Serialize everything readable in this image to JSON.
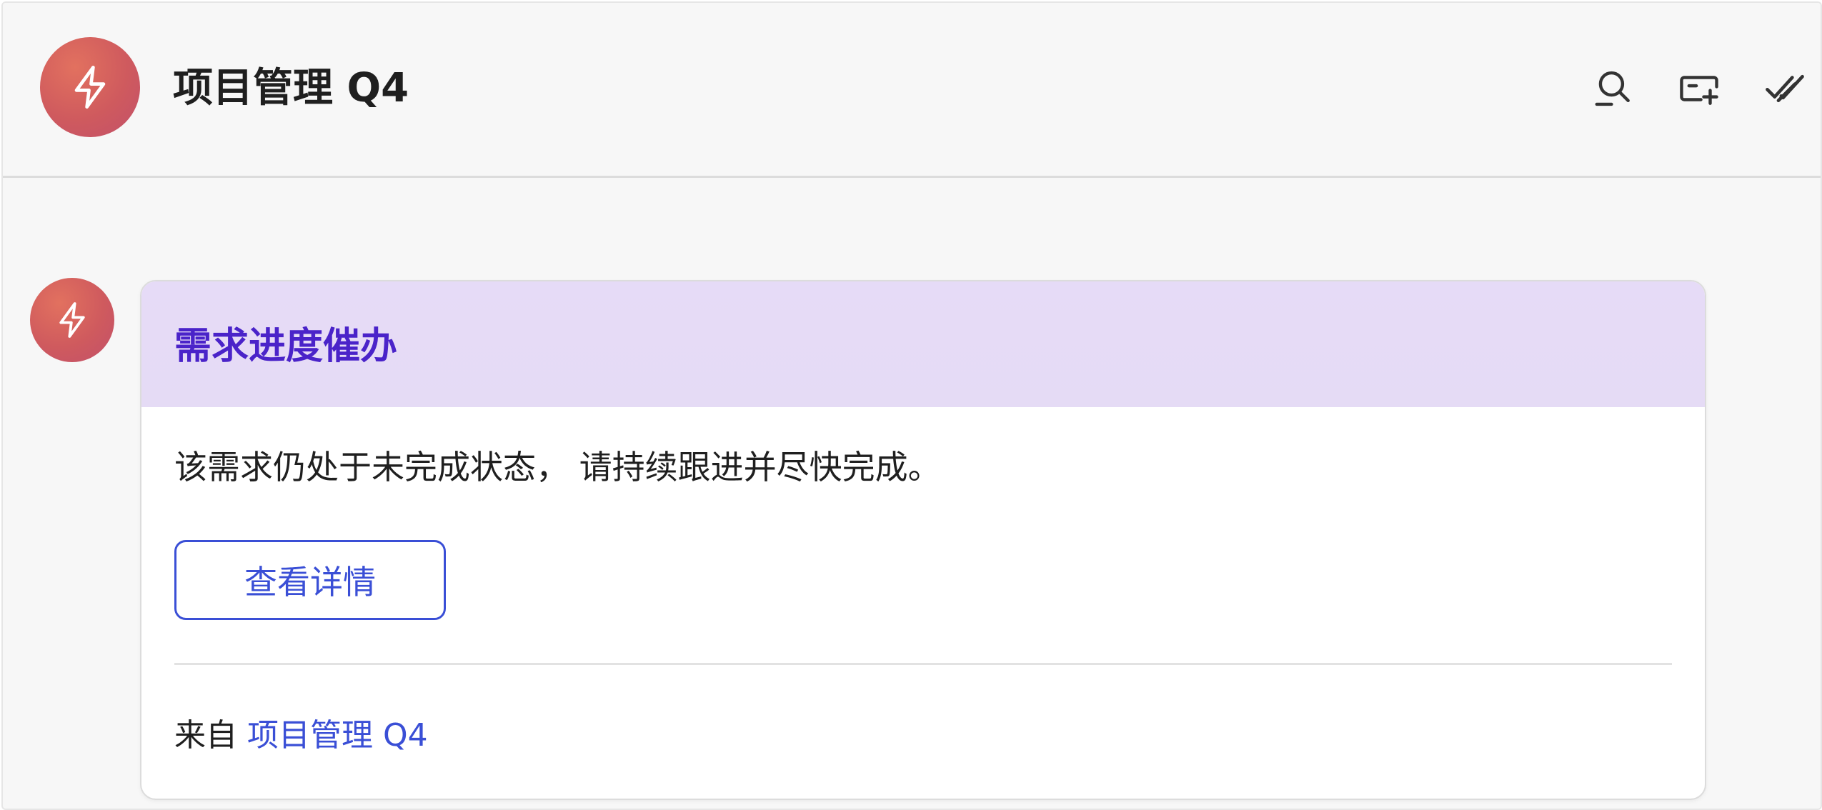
{
  "header": {
    "title": "项目管理 Q4",
    "actions": [
      {
        "icon": "search-person-icon"
      },
      {
        "icon": "add-card-icon"
      },
      {
        "icon": "double-check-icon"
      }
    ]
  },
  "message": {
    "avatar_icon": "lightning-icon",
    "card": {
      "title": "需求进度催办",
      "body": "该需求仍处于未完成状态， 请持续跟进并尽快完成。",
      "button_label": "查看详情",
      "source_prefix": "来自",
      "source_link": "项目管理 Q4"
    }
  },
  "colors": {
    "accent": "#3a4fd6",
    "title_purple": "#4a23c9",
    "card_header_bg": "#e6dbf7",
    "avatar_red": "#cf5a5e"
  }
}
